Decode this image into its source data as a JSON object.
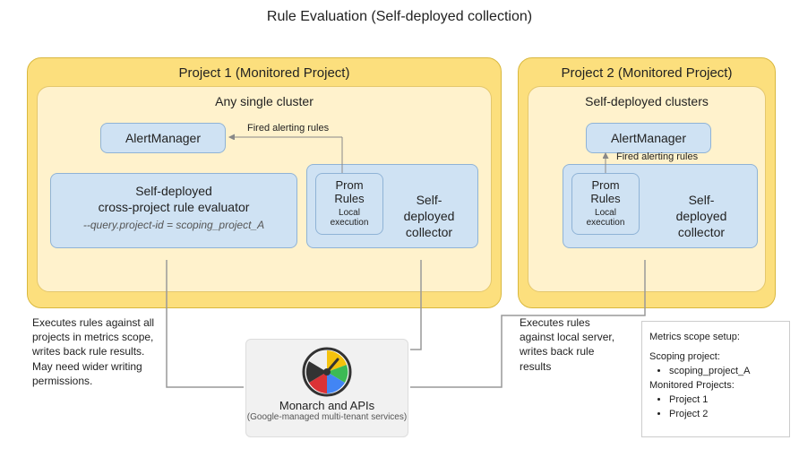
{
  "title": "Rule Evaluation (Self-deployed collection)",
  "project1": {
    "title": "Project 1 (Monitored Project)",
    "cluster_title": "Any single cluster",
    "alertmanager": "AlertManager",
    "firing_label": "Fired alerting rules",
    "evaluator_line1": "Self-deployed",
    "evaluator_line2": "cross-project rule evaluator",
    "evaluator_flag": "--query.project-id = scoping_project_A",
    "prom_title": "Prom Rules",
    "prom_sub": "Local execution",
    "collector_line1": "Self-",
    "collector_line2": "deployed",
    "collector_line3": "collector"
  },
  "project2": {
    "title": "Project 2 (Monitored Project)",
    "cluster_title": "Self-deployed clusters",
    "alertmanager": "AlertManager",
    "firing_label": "Fired alerting rules",
    "prom_title": "Prom Rules",
    "prom_sub": "Local execution",
    "collector_line1": "Self-",
    "collector_line2": "deployed",
    "collector_line3": "collector"
  },
  "notes": {
    "left": "Executes rules against all projects in metrics scope, writes back rule results. May need wider writing permissions.",
    "mid": "Executes rules against local server, writes back rule results"
  },
  "monarch": {
    "title": "Monarch and APIs",
    "sub": "(Google-managed multi-tenant services)"
  },
  "scope": {
    "heading": "Metrics scope setup:",
    "scoping_label": "Scoping project:",
    "scoping_value": "scoping_project_A",
    "monitored_label": "Monitored Projects:",
    "monitored": [
      "Project 1",
      "Project 2"
    ]
  }
}
